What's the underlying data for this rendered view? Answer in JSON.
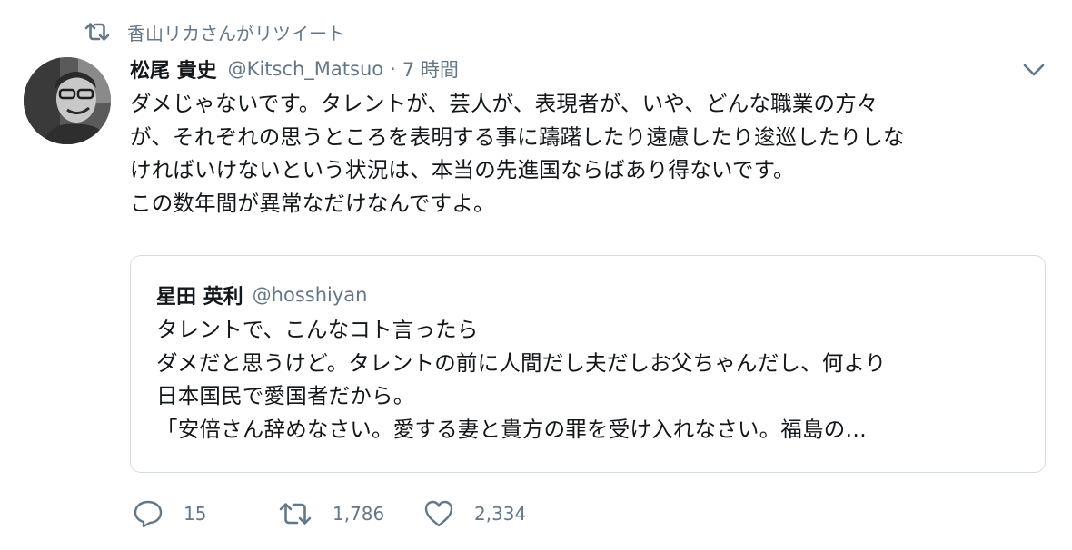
{
  "retweet_context": {
    "icon": "retweet-icon",
    "label": "香山リカさんがリツイート"
  },
  "tweet": {
    "author_name": "松尾 貴史",
    "author_handle": "@Kitsch_Matsuo",
    "separator": "·",
    "timestamp": "7 時間",
    "text_lines": [
      "ダメじゃないです。タレントが、芸人が、表現者が、いや、どんな職業の方々",
      "が、それぞれの思うところを表明する事に躊躇したり遠慮したり逡巡したりしな",
      "ければいけないという状況は、本当の先進国ならばあり得ないです。",
      "この数年間が異常なだけなんですよ。"
    ]
  },
  "quote": {
    "author_name": "星田 英利",
    "author_handle": "@hosshiyan",
    "text_lines": [
      "タレントで、こんなコト言ったら",
      "ダメだと思うけど。タレントの前に人間だし夫だしお父ちゃんだし、何より",
      "日本国民で愛国者だから。",
      "「安倍さん辞めなさい。愛する妻と貴方の罪を受け入れなさい。福島の…"
    ]
  },
  "actions": {
    "reply_count": "15",
    "retweet_count": "1,786",
    "like_count": "2,334"
  },
  "icons": {
    "retweet": "retweet-icon",
    "reply": "reply-icon",
    "like": "heart-icon",
    "caret": "chevron-down-icon"
  },
  "colors": {
    "text": "#14171a",
    "secondary": "#657786",
    "border": "#d5dde3"
  }
}
